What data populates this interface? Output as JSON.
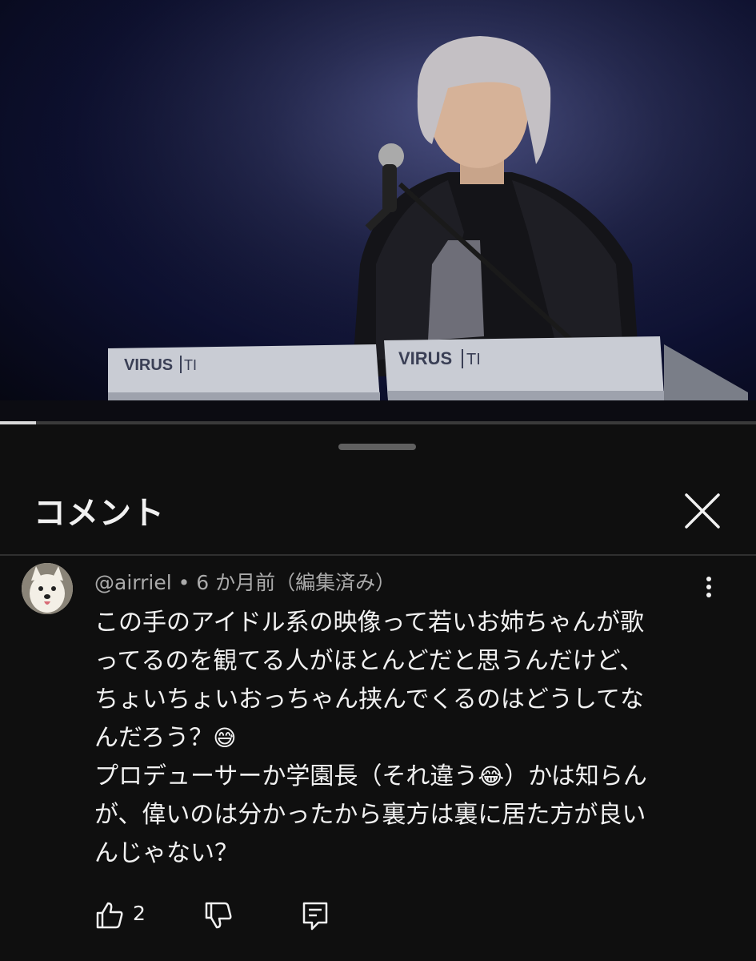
{
  "video": {
    "keyboard_brand_left": "VIRUS",
    "keyboard_model_left": "TI",
    "keyboard_brand_right": "VIRUS",
    "keyboard_model_right": "TI",
    "progress_fraction": 0.048
  },
  "sheet": {
    "title": "コメント"
  },
  "comment": {
    "author": "@airriel",
    "separator": " • ",
    "time": "6 か月前",
    "edited": "（編集済み）",
    "lines": [
      "この手のアイドル系の映像って若いお姉ちゃんが歌",
      "ってるのを観てる人がほとんどだと思うんだけど、",
      "ちょいちょいおっちゃん挟んでくるのはどうしてな",
      "んだろう？",
      "プロデューサーか学園長（それ違う",
      "）かは知らん",
      "が、偉いのは分かったから裏方は裏に居た方が良い",
      "んじゃない？"
    ],
    "emoji_1": "😅",
    "emoji_2": "😂",
    "like_count": "2"
  },
  "icons": {
    "close": "close-icon",
    "more": "more-vert-icon",
    "like": "thumb-up-icon",
    "dislike": "thumb-down-icon",
    "reply": "reply-icon"
  }
}
